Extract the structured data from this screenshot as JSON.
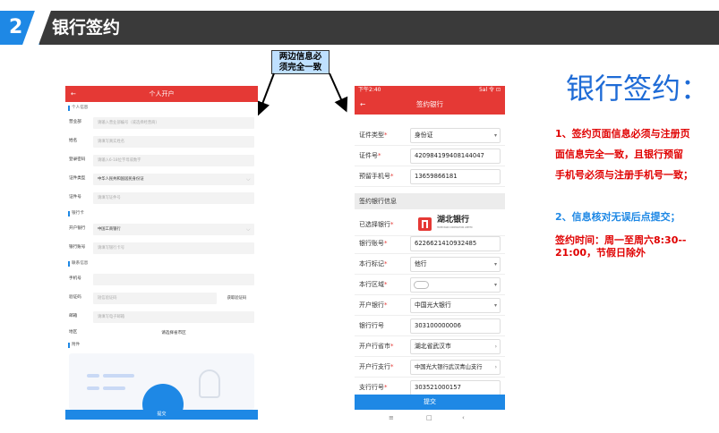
{
  "header": {
    "number": "2",
    "title": "银行签约"
  },
  "note": {
    "line1": "两边信息必",
    "line2": "须完全一致"
  },
  "left_phone": {
    "back": "←",
    "title": "个人开户",
    "sections": {
      "personal": "个人信息",
      "bank": "银行卡",
      "contact": "联系信息",
      "attach": "附件"
    },
    "rows": [
      {
        "label": "营业部",
        "value": "请输入营业部编号（或选择经营商）"
      },
      {
        "label": "姓名",
        "value": "请填写真实姓名"
      },
      {
        "label": "登录密码",
        "value": "请输入6-18位字母或数字"
      },
      {
        "label": "证件类型",
        "value": "中华人民共和国居民身份证"
      },
      {
        "label": "证件号",
        "value": "请填写证件号"
      },
      {
        "label": "开户银行",
        "value": "中国工商银行"
      },
      {
        "label": "银行账号",
        "value": "请填写银行卡号"
      },
      {
        "label": "手机号",
        "value": ""
      },
      {
        "label": "验证码",
        "value": "短信验证码"
      },
      {
        "label": "邮箱",
        "value": "请填写电子邮箱"
      },
      {
        "label": "地区",
        "value": "请选择省市区"
      }
    ],
    "get_code": "获取验证码",
    "submit": "提交"
  },
  "right_phone": {
    "status_time": "下午2:40",
    "status_icons": "5al 令 ⊡",
    "back": "←",
    "title": "签约银行",
    "rows_top": [
      {
        "label": "证件类型",
        "value": "身份证"
      },
      {
        "label": "证件号",
        "value": "420984199408144047"
      },
      {
        "label": "预留手机号",
        "value": "13659866181"
      }
    ],
    "section": "签约银行信息",
    "selected_bank_label": "已选择银行",
    "bank_logo_text": "湖北银行",
    "bank_logo_sub": "HUBEI BANK CORPORATION LIMITED",
    "rows_bottom": [
      {
        "label": "银行账号",
        "value": "6226621410932485"
      },
      {
        "label": "本行标记",
        "value": "他行"
      },
      {
        "label": "本行区域",
        "value": ""
      },
      {
        "label": "开户银行",
        "value": "中国光大银行"
      },
      {
        "label": "银行行号",
        "value": "303100000006"
      },
      {
        "label": "开户行省市",
        "value": "湖北省武汉市"
      },
      {
        "label": "开户行支行",
        "value": "中国光大银行武汉青山支行"
      },
      {
        "label": "支行行号",
        "value": "303521000157"
      }
    ],
    "submit": "提交",
    "nav": [
      "≡",
      "□",
      "‹"
    ]
  },
  "explain": {
    "title": "银行签约：",
    "p1_l1": "1、签约页面信息必须与注册页",
    "p1_l2": "面信息完全一致，且银行预留",
    "p1_l3": "手机号必须与注册手机号一致；",
    "p2": "2、信息核对无误后点提交；",
    "p3_l1": "签约时间：周一至周六8:30--",
    "p3_l2": "21:00，节假日除外"
  },
  "colors": {
    "header_bg": "#3a3a3a",
    "accent_blue": "#1e88e5",
    "brand_red": "#e53935",
    "text_red": "#e00000",
    "title_blue": "#1e6bd6"
  }
}
